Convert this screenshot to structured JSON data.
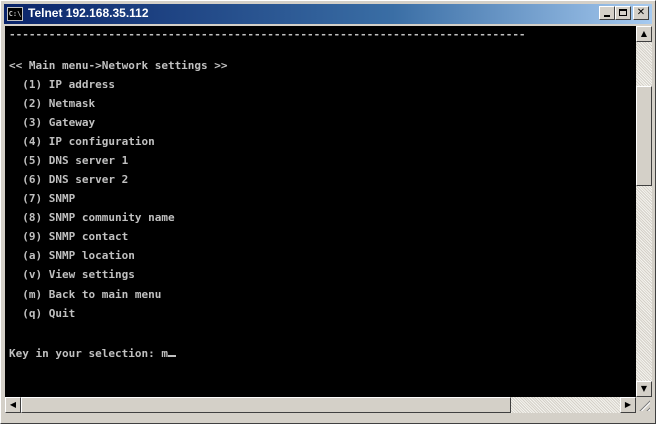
{
  "window": {
    "title": "Telnet 192.168.35.112",
    "icon": "console-icon",
    "icon_text": "C:\\"
  },
  "titlebar_buttons": {
    "close_glyph": "✕"
  },
  "console": {
    "separator": "------------------------------------------------------------------------------",
    "header": "<< Main menu->Network settings >>",
    "menu_items": [
      "  (1) IP address",
      "  (2) Netmask",
      "  (3) Gateway",
      "  (4) IP configuration",
      "  (5) DNS server 1",
      "  (6) DNS server 2",
      "  (7) SNMP",
      "  (8) SNMP community name",
      "  (9) SNMP contact",
      "  (a) SNMP location",
      "  (v) View settings",
      "  (m) Back to main menu",
      "  (q) Quit"
    ],
    "prompt": "Key in your selection: ",
    "input_value": "m"
  },
  "scrollbars": {
    "up_arrow": "▲",
    "down_arrow": "▼",
    "left_arrow": "◀",
    "right_arrow": "▶"
  }
}
